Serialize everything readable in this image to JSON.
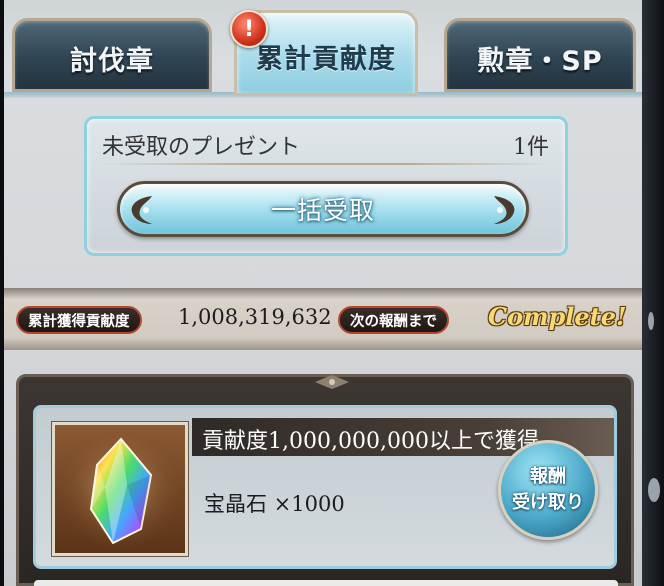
{
  "tabs": [
    {
      "label": "討伐章",
      "active": false
    },
    {
      "label": "累計貢献度",
      "active": true
    },
    {
      "label": "勲章・SP",
      "active": false
    }
  ],
  "tab_notice": "!",
  "present": {
    "label": "未受取のプレゼント",
    "count": "1件",
    "claim_all_label": "一括受取"
  },
  "stats": {
    "total_label": "累計獲得貢献度",
    "total_value": "1,008,319,632",
    "next_label": "次の報酬まで",
    "next_value": "Complete!"
  },
  "reward": {
    "condition": "貢献度1,000,000,000以上で獲得",
    "item": "宝晶石 ×1000",
    "thumbnail_icon": "crystal-icon",
    "button_line1": "報酬",
    "button_line2": "受け取り"
  },
  "colors": {
    "accent_cyan": "#8fcde0",
    "complete_gold": "#f5d878",
    "pill_border": "#b6452e"
  }
}
